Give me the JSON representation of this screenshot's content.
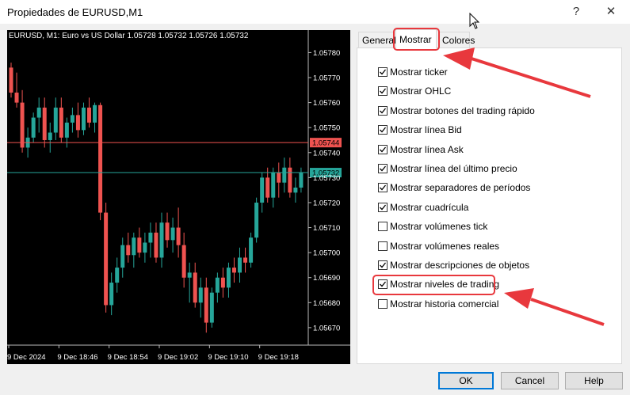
{
  "window": {
    "title": "Propiedades de EURUSD,M1",
    "help_glyph": "?",
    "close_glyph": "✕"
  },
  "tabs": [
    {
      "label": "General",
      "active": false
    },
    {
      "label": "Mostrar",
      "active": true
    },
    {
      "label": "Colores",
      "active": false
    }
  ],
  "options": [
    {
      "label": "Mostrar ticker",
      "checked": true
    },
    {
      "label": "Mostrar OHLC",
      "checked": true
    },
    {
      "label": "Mostrar botones del trading rápido",
      "checked": true
    },
    {
      "label": "Mostrar línea Bid",
      "checked": true
    },
    {
      "label": "Mostrar línea Ask",
      "checked": true
    },
    {
      "label": "Mostrar línea del último precio",
      "checked": true
    },
    {
      "label": "Mostrar separadores de períodos",
      "checked": true
    },
    {
      "label": "Mostrar cuadrícula",
      "checked": true
    },
    {
      "label": "Mostrar volúmenes tick",
      "checked": false
    },
    {
      "label": "Mostrar volúmenes reales",
      "checked": false
    },
    {
      "label": "Mostrar descripciones de objetos",
      "checked": true
    },
    {
      "label": "Mostrar niveles de trading",
      "checked": true
    },
    {
      "label": "Mostrar historia comercial",
      "checked": false
    }
  ],
  "buttons": {
    "ok": "OK",
    "cancel": "Cancel",
    "help": "Help"
  },
  "chart": {
    "header": "EURUSD, M1:  Euro vs US Dollar  1.05728 1.05732 1.05726 1.05732",
    "ask_label": "1.05744",
    "bid_label": "1.05732",
    "colors": {
      "bull": "#26a69a",
      "bear": "#ef5350",
      "ask_line": "#ef5350",
      "bid_line": "#26a69a"
    }
  },
  "chart_data": {
    "type": "candlestick",
    "y_ticks": [
      "1.05780",
      "1.05770",
      "1.05760",
      "1.05750",
      "1.05740",
      "1.05730",
      "1.05720",
      "1.05710",
      "1.05700",
      "1.05690",
      "1.05680",
      "1.05670"
    ],
    "x_ticks": [
      "9 Dec 2024",
      "9 Dec 18:46",
      "9 Dec 18:54",
      "9 Dec 19:02",
      "9 Dec 19:10",
      "9 Dec 19:18"
    ],
    "ylim": [
      1.05663,
      1.05789
    ],
    "ask": 1.05744,
    "bid": 1.05732,
    "candles": [
      [
        1.05774,
        1.05776,
        1.05762,
        1.05764
      ],
      [
        1.05764,
        1.05772,
        1.05758,
        1.0576
      ],
      [
        1.0576,
        1.05765,
        1.0574,
        1.05742
      ],
      [
        1.05742,
        1.0575,
        1.05738,
        1.05746
      ],
      [
        1.05746,
        1.05756,
        1.05744,
        1.05754
      ],
      [
        1.05754,
        1.05762,
        1.05748,
        1.05758
      ],
      [
        1.05758,
        1.05762,
        1.05742,
        1.05745
      ],
      [
        1.05745,
        1.05752,
        1.0574,
        1.05748
      ],
      [
        1.05748,
        1.05762,
        1.05745,
        1.05758
      ],
      [
        1.05758,
        1.05762,
        1.05744,
        1.05746
      ],
      [
        1.05746,
        1.05754,
        1.05742,
        1.05752
      ],
      [
        1.05752,
        1.05758,
        1.05748,
        1.05755
      ],
      [
        1.05755,
        1.0576,
        1.05746,
        1.05749
      ],
      [
        1.05749,
        1.0576,
        1.05747,
        1.05758
      ],
      [
        1.05758,
        1.05762,
        1.0575,
        1.05752
      ],
      [
        1.05752,
        1.0576,
        1.05748,
        1.05759
      ],
      [
        1.05759,
        1.0576,
        1.05713,
        1.05716
      ],
      [
        1.05716,
        1.0572,
        1.05676,
        1.05679
      ],
      [
        1.05679,
        1.05692,
        1.05675,
        1.05688
      ],
      [
        1.05688,
        1.05698,
        1.05684,
        1.05694
      ],
      [
        1.05694,
        1.05706,
        1.0569,
        1.05703
      ],
      [
        1.05703,
        1.05708,
        1.05696,
        1.05699
      ],
      [
        1.05699,
        1.05708,
        1.05694,
        1.05706
      ],
      [
        1.05706,
        1.0571,
        1.05698,
        1.057
      ],
      [
        1.057,
        1.05708,
        1.05696,
        1.05704
      ],
      [
        1.05704,
        1.05712,
        1.05698,
        1.05708
      ],
      [
        1.05708,
        1.05712,
        1.05696,
        1.05698
      ],
      [
        1.05698,
        1.05716,
        1.05694,
        1.05712
      ],
      [
        1.05712,
        1.05716,
        1.05702,
        1.05705
      ],
      [
        1.05705,
        1.05714,
        1.057,
        1.0571
      ],
      [
        1.0571,
        1.05718,
        1.05698,
        1.05703
      ],
      [
        1.05703,
        1.05708,
        1.05686,
        1.0569
      ],
      [
        1.0569,
        1.05696,
        1.0568,
        1.05692
      ],
      [
        1.05692,
        1.05696,
        1.05678,
        1.0568
      ],
      [
        1.0568,
        1.0569,
        1.05674,
        1.05686
      ],
      [
        1.05686,
        1.0569,
        1.05668,
        1.05672
      ],
      [
        1.05672,
        1.05686,
        1.0567,
        1.05684
      ],
      [
        1.05684,
        1.05692,
        1.0568,
        1.0569
      ],
      [
        1.0569,
        1.05694,
        1.05682,
        1.05686
      ],
      [
        1.05686,
        1.05696,
        1.05682,
        1.05694
      ],
      [
        1.05694,
        1.05698,
        1.05688,
        1.05692
      ],
      [
        1.05692,
        1.05702,
        1.05688,
        1.05698
      ],
      [
        1.05698,
        1.05702,
        1.05692,
        1.05696
      ],
      [
        1.05696,
        1.05708,
        1.05694,
        1.05706
      ],
      [
        1.05706,
        1.05722,
        1.05704,
        1.0572
      ],
      [
        1.0572,
        1.05732,
        1.05716,
        1.0573
      ],
      [
        1.0573,
        1.05734,
        1.0572,
        1.05722
      ],
      [
        1.05722,
        1.05734,
        1.05718,
        1.05732
      ],
      [
        1.05732,
        1.05736,
        1.05722,
        1.05728
      ],
      [
        1.05728,
        1.05738,
        1.05724,
        1.05734
      ],
      [
        1.05734,
        1.05738,
        1.05722,
        1.05724
      ],
      [
        1.05724,
        1.0573,
        1.0572,
        1.05726
      ],
      [
        1.05726,
        1.05734,
        1.05724,
        1.05732
      ]
    ]
  }
}
